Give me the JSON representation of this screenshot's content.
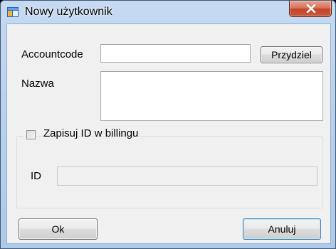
{
  "window": {
    "title": "Nowy użytkownik",
    "close_label": "x"
  },
  "form": {
    "accountcode_label": "Accountcode",
    "accountcode_value": "",
    "assign_button": "Przydziel",
    "name_label": "Nazwa",
    "name_value": "",
    "billing_checkbox_label": "Zapisuj ID w billingu",
    "billing_checked": false,
    "id_label": "ID",
    "id_value": ""
  },
  "buttons": {
    "ok": "Ok",
    "cancel": "Anuluj"
  },
  "colors": {
    "accent_close": "#c4452a",
    "frame": "#b8d0ee",
    "client": "#f0f0f0"
  }
}
